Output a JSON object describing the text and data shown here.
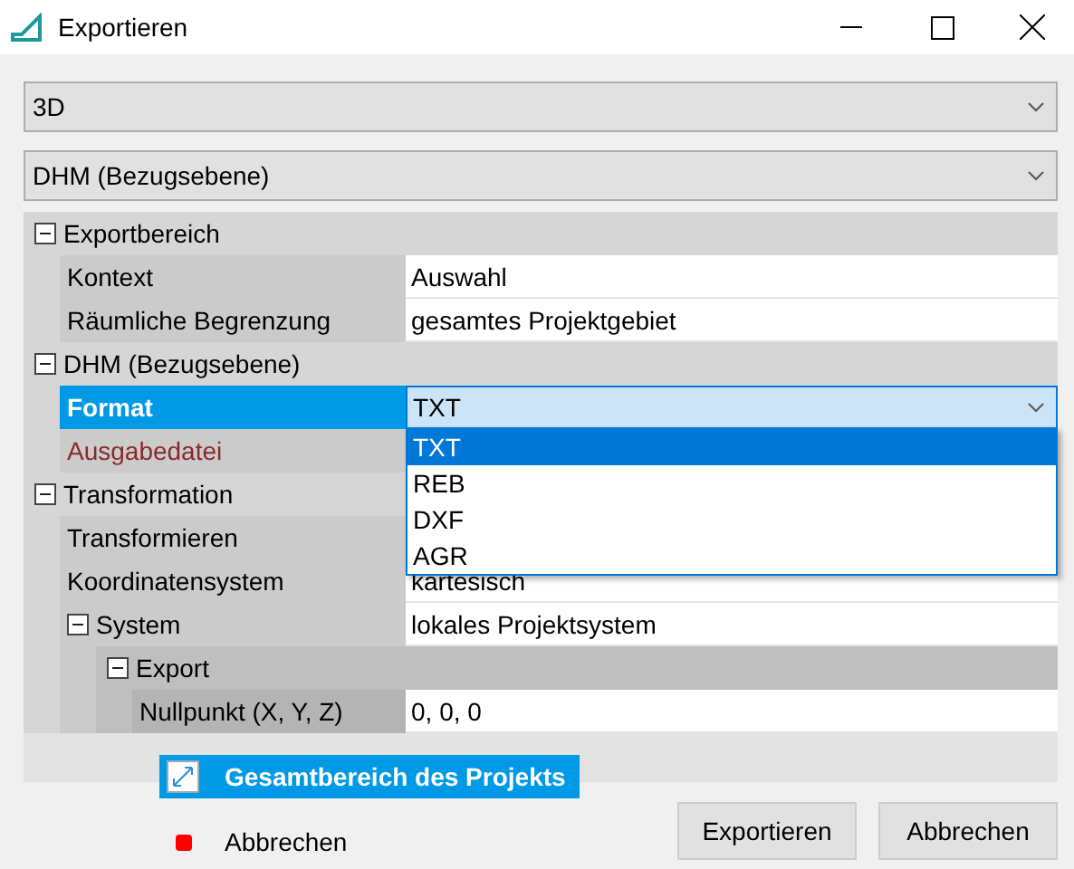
{
  "window": {
    "title": "Exportieren"
  },
  "combos": [
    {
      "value": "3D"
    },
    {
      "value": "DHM (Bezugsebene)"
    }
  ],
  "property_grid": [
    {
      "kind": "category",
      "label": "Exportbereich",
      "expanded": true,
      "children": [
        {
          "kind": "property",
          "label": "Kontext",
          "value": "Auswahl",
          "selected": false
        },
        {
          "kind": "property",
          "label": "Räumliche Begrenzung",
          "value": "gesamtes Projektgebiet",
          "selected": false
        }
      ]
    },
    {
      "kind": "category",
      "label": "DHM (Bezugsebene)",
      "expanded": true,
      "children": [
        {
          "kind": "property",
          "label": "Format",
          "value": "TXT",
          "selected": true,
          "dropdown": [
            {
              "label": "TXT",
              "selected": true
            },
            {
              "label": "REB",
              "selected": false
            },
            {
              "label": "DXF",
              "selected": false
            },
            {
              "label": "AGR",
              "selected": false
            }
          ]
        },
        {
          "kind": "property",
          "label": "Ausgabedatei",
          "selected": false,
          "invalid": true
        }
      ]
    },
    {
      "kind": "category",
      "label": "Transformation",
      "expanded": true,
      "children": [
        {
          "kind": "property",
          "label": "Transformieren",
          "selected": false
        },
        {
          "kind": "property",
          "label": "Koordinatensystem",
          "value": "kartesisch",
          "selected": false
        },
        {
          "kind": "property",
          "label": "System",
          "value": "lokales Projektsystem",
          "selected": false,
          "expanded": true,
          "children": [
            {
              "kind": "category",
              "label": "Export",
              "expanded": true,
              "children": [
                {
                  "kind": "property",
                  "label": "Nullpunkt (X, Y, Z)",
                  "value": "0, 0, 0",
                  "selected": false
                }
              ]
            }
          ]
        }
      ]
    }
  ],
  "menu": [
    {
      "kind": "extent",
      "label": "Gesamtbereich des Projekts",
      "selected": true
    },
    {
      "kind": "stop",
      "label": "Abbrechen",
      "selected": false
    }
  ],
  "buttons": [
    "Exportieren",
    "Abbrechen"
  ]
}
